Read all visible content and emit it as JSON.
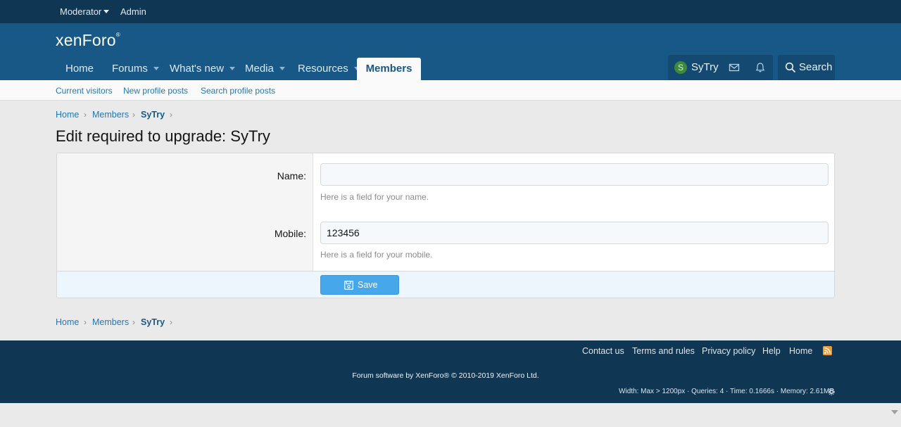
{
  "staffbar": {
    "moderator": "Moderator",
    "admin": "Admin"
  },
  "header": {
    "logo": "xenForo",
    "logo_mark": "®",
    "nav": [
      {
        "label": "Home"
      },
      {
        "label": "Forums"
      },
      {
        "label": "What's new"
      },
      {
        "label": "Media"
      },
      {
        "label": "Resources"
      },
      {
        "label": "Members"
      }
    ],
    "user": {
      "avatar_letter": "S",
      "name": "SyTry"
    },
    "search_label": "Search"
  },
  "subnav": {
    "items": [
      "Current visitors",
      "New profile posts",
      "Search profile posts"
    ]
  },
  "breadcrumb": {
    "items": [
      "Home",
      "Members",
      "SyTry"
    ]
  },
  "page_title": "Edit required to upgrade: SyTry",
  "form": {
    "name_label": "Name:",
    "name_value": "",
    "name_hint": "Here is a field for your name.",
    "mobile_label": "Mobile:",
    "mobile_value": "123456",
    "mobile_hint": "Here is a field for your mobile.",
    "save_label": "Save"
  },
  "footer": {
    "links": [
      "Contact us",
      "Terms and rules",
      "Privacy policy",
      "Help",
      "Home"
    ],
    "copyright": "Forum software by XenForo® © 2010-2019 XenForo Ltd.",
    "debug": "Width: Max > 1200px · Queries: 4 · Time: 0.1666s · Memory: 2.61MB"
  },
  "colors": {
    "header_bg": "#185886",
    "staffbar_bg": "#0f3652",
    "link": "#2577b1",
    "button": "#47a7eb"
  }
}
